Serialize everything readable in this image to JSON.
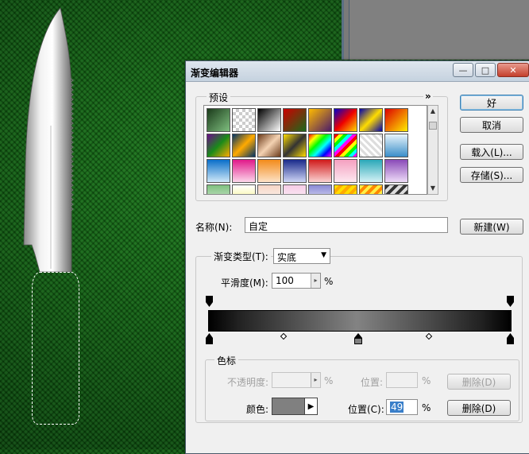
{
  "dialog": {
    "title": "渐变编辑器",
    "minimize_glyph": "—",
    "maximize_glyph": "□",
    "close_glyph": "✕"
  },
  "presets": {
    "label": "预设",
    "expand_glyph": "»",
    "swatches": [
      "linear-gradient(135deg,#1a3a1a,#7fbf7f)",
      "repeating-conic-gradient(#ccc 0 25%,#fff 0 50%) 0 0/8px 8px",
      "linear-gradient(135deg,#000,#fff)",
      "linear-gradient(135deg,#c00,#1a6a1a)",
      "linear-gradient(135deg,#fb0,#4a1a6a)",
      "linear-gradient(135deg,#00c,#e00,#fd0)",
      "linear-gradient(135deg,#00a,#fd0,#00a)",
      "linear-gradient(135deg,#d00,#fe0)",
      "linear-gradient(135deg,#6a0a8a,#1a8a1a,#fa0)",
      "linear-gradient(135deg,#036,#fa0,#036)",
      "linear-gradient(135deg,#6b3b1b,#f4d2b2,#6b3b1b)",
      "linear-gradient(135deg,#fd0,#333,#fd0)",
      "linear-gradient(135deg,#f00,#ff0,#0f0,#0ff,#00f,#f0f)",
      "repeating-linear-gradient(135deg,#f00 0 4px,#ff0 4px 8px,#0f0 8px 12px,#0ff 12px 16px,#f0f 16px 20px)",
      "repeating-linear-gradient(45deg,#ddd 0 3px,#fff 3px 6px)",
      "linear-gradient(180deg,#e8f4fb,#3a8ec9)",
      "linear-gradient(180deg,#0a6ec9,#cfe8f8)",
      "linear-gradient(180deg,#e01a8a,#fcd6ea)",
      "linear-gradient(180deg,#f28b1a,#fde2c6)",
      "linear-gradient(180deg,#1a2a8a,#cfd6f6)",
      "linear-gradient(180deg,#d01a1a,#fbd2d2)",
      "linear-gradient(180deg,#f4a0c0,#fde8f0)",
      "linear-gradient(180deg,#2aa8b8,#d6f2f6)",
      "linear-gradient(180deg,#8a4ab8,#eedcf8)",
      "linear-gradient(180deg,#7fc07f,#e8f6e8)",
      "linear-gradient(180deg,#fff,#f6f26a)",
      "linear-gradient(180deg,#f6d6c6,#fff)",
      "linear-gradient(180deg,#f6cce6,#fff)",
      "linear-gradient(180deg,#8a8ad6,#fff)",
      "repeating-linear-gradient(135deg,#fd0 0 4px,#fa0 4px 8px)",
      "repeating-linear-gradient(135deg,#fe4 0 4px,#f80 4px 8px)",
      "repeating-linear-gradient(135deg,#333 0 4px,#ddd 4px 8px)"
    ]
  },
  "buttons": {
    "ok": "好",
    "cancel": "取消",
    "load": "载入(L)...",
    "save": "存储(S)...",
    "new": "新建(W)",
    "delete_opacity": "删除(D)",
    "delete_color": "删除(D)"
  },
  "name_field": {
    "label": "名称(N):",
    "value": "自定"
  },
  "gradient_type": {
    "label": "渐变类型(T):",
    "value": "实底",
    "arrow": "▼"
  },
  "smoothness": {
    "label": "平滑度(M):",
    "value": "100",
    "unit": "%",
    "spin_glyph": "▸"
  },
  "stops": {
    "group_label": "色标",
    "opacity_label": "不透明度:",
    "opacity_value": "",
    "opacity_unit": "%",
    "opacity_location_label": "位置:",
    "opacity_location_value": "",
    "opacity_location_unit": "%",
    "color_label": "颜色:",
    "color_hex": "#808080",
    "color_arrow": "▶",
    "color_location_label": "位置(C):",
    "color_location_value": "49",
    "color_location_unit": "%"
  },
  "gradient": {
    "colors": [
      "#000000",
      "#808080",
      "#000000"
    ],
    "selected_stop_location": 49
  }
}
